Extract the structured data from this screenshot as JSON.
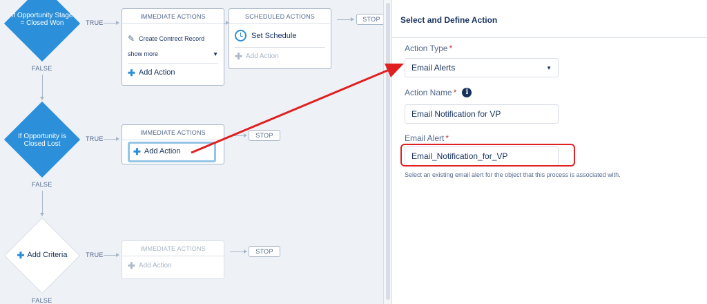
{
  "flow": {
    "criteria": [
      {
        "label": "If Opportunity Stage = Closed Won",
        "true_label": "TRUE",
        "false_label": "FALSE"
      },
      {
        "label": "If Opportunity is Closed Lost",
        "true_label": "TRUE",
        "false_label": "FALSE"
      },
      {
        "label": "Add Criteria",
        "true_label": "TRUE",
        "false_label": "FALSE"
      }
    ],
    "immediate_actions_label": "IMMEDIATE ACTIONS",
    "scheduled_actions_label": "SCHEDULED ACTIONS",
    "action_1": "Create Contrect Record",
    "show_more": "show more",
    "add_action": "Add Action",
    "set_schedule": "Set Schedule",
    "stop": "STOP"
  },
  "panel": {
    "title": "Select and Define Action",
    "action_type_label": "Action Type",
    "action_type_value": "Email Alerts",
    "action_name_label": "Action Name",
    "action_name_value": "Email Notification for VP",
    "email_alert_label": "Email Alert",
    "email_alert_value": "Email_Notification_for_VP",
    "email_alert_hint": "Select an existing email alert for the object that this process is associated with.",
    "required_mark": "*",
    "info_glyph": "i"
  },
  "colors": {
    "accent": "#2b90d9",
    "annotation": "#e02020"
  }
}
